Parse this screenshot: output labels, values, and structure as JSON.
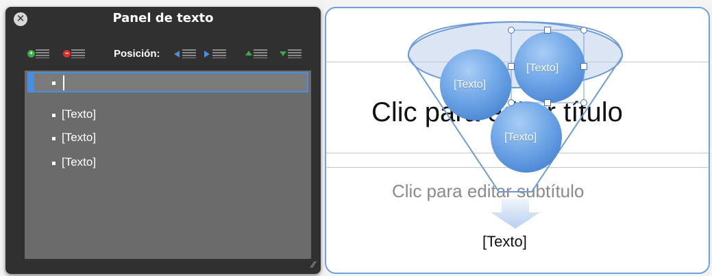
{
  "panel": {
    "title": "Panel de texto",
    "position_label": "Posición:",
    "outline_items": [
      "",
      "[Texto]",
      "[Texto]",
      "[Texto]"
    ]
  },
  "slide": {
    "title_placeholder": "Clic para editar título",
    "subtitle_placeholder": "Clic para editar subtítulo",
    "smartart_labels": [
      "[Texto]",
      "[Texto]",
      "[Texto]"
    ],
    "bottom_label": "[Texto]"
  },
  "colors": {
    "accent": "#4a8ee0",
    "sphere": "#6ea6e6",
    "panel_bg": "#282828"
  }
}
